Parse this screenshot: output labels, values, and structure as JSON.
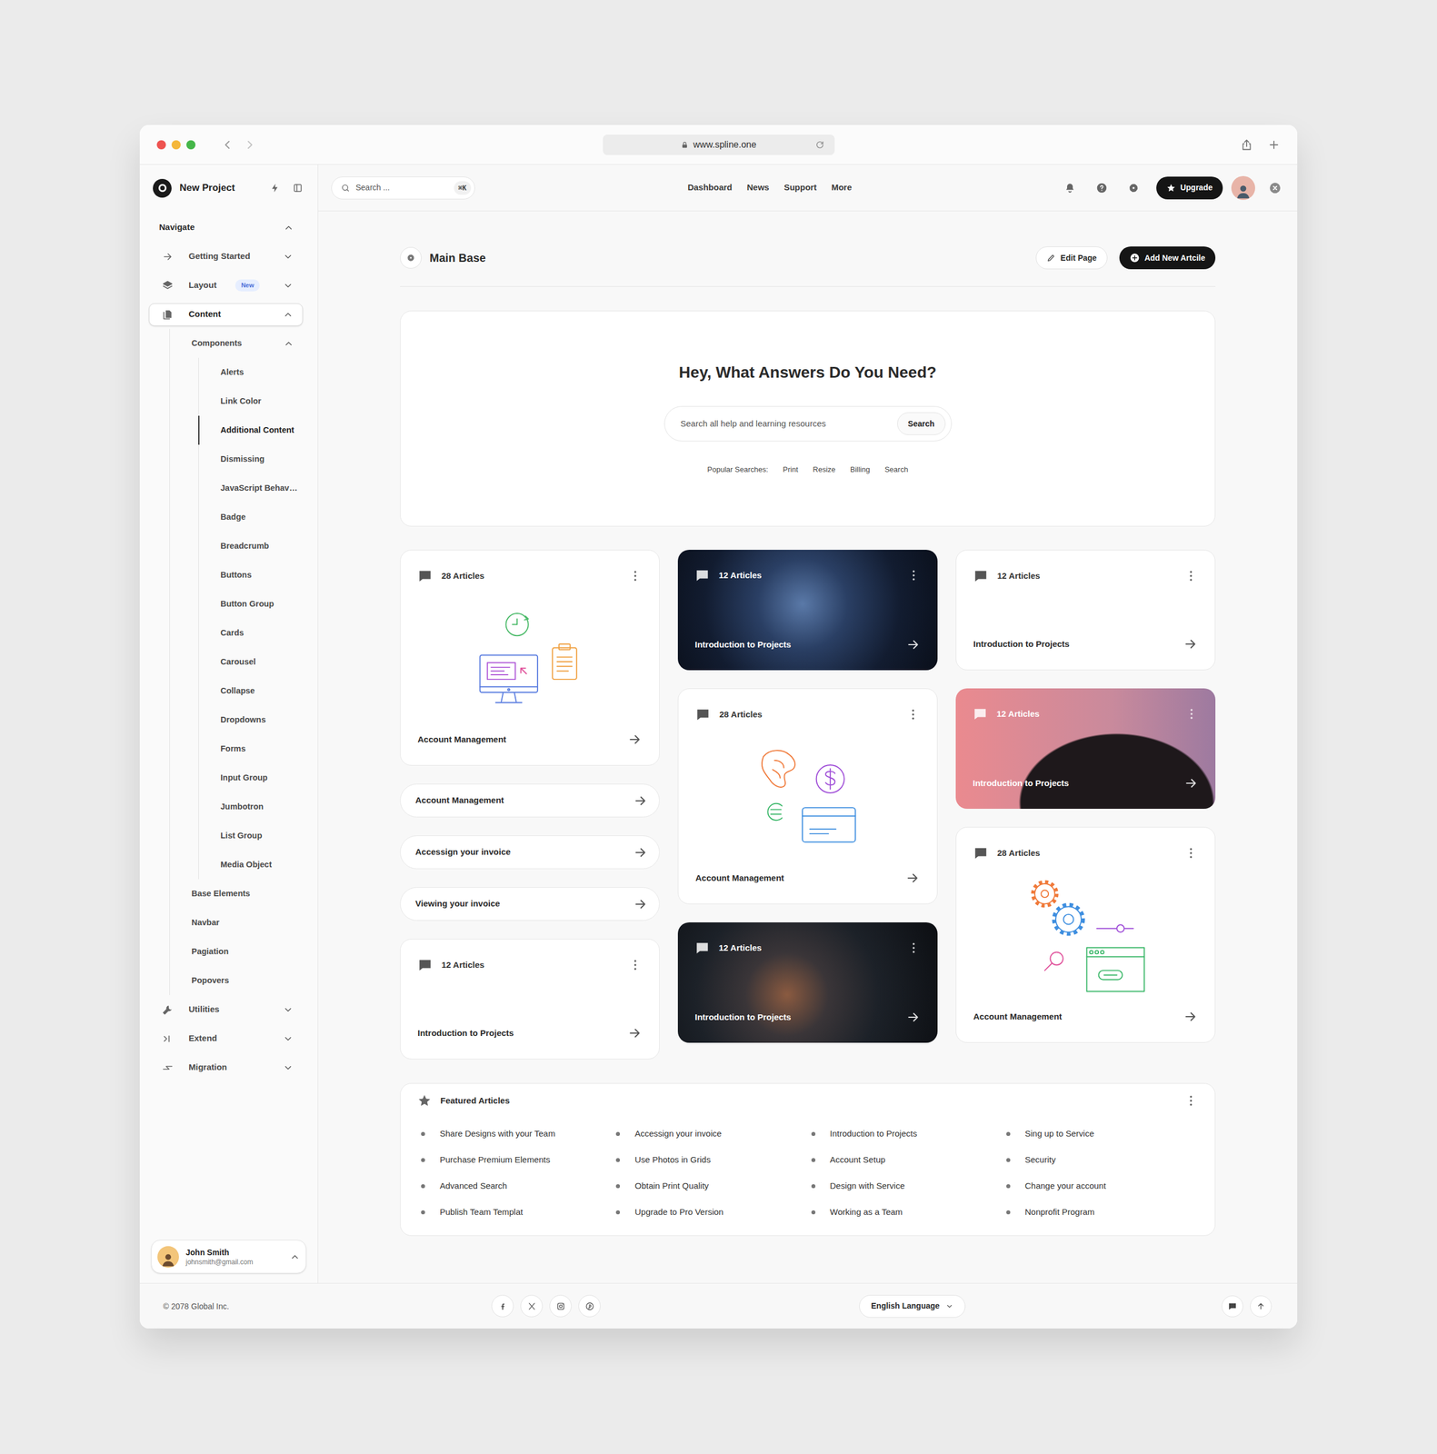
{
  "browser": {
    "url": "www.spline.one"
  },
  "sidebar": {
    "project": "New Project",
    "section": {
      "label": "Navigate",
      "expanded": true
    },
    "items": [
      {
        "label": "Getting Started",
        "expanded": false,
        "selected": false
      },
      {
        "label": "Layout",
        "badge": "New",
        "expanded": false,
        "selected": false
      },
      {
        "label": "Content",
        "expanded": true,
        "selected": true,
        "children": [
          {
            "label": "Components",
            "expanded": true,
            "children": [
              {
                "label": "Alerts",
                "selected": false
              },
              {
                "label": "Link Color",
                "selected": false
              },
              {
                "label": "Additional Content",
                "selected": true
              },
              {
                "label": "Dismissing",
                "selected": false
              },
              {
                "label": "JavaScript Behav…",
                "selected": false
              },
              {
                "label": "Badge",
                "selected": false
              },
              {
                "label": "Breadcrumb",
                "selected": false
              },
              {
                "label": "Buttons",
                "selected": false
              },
              {
                "label": "Button Group",
                "selected": false
              },
              {
                "label": "Cards",
                "selected": false
              },
              {
                "label": "Carousel",
                "selected": false
              },
              {
                "label": "Collapse",
                "selected": false
              },
              {
                "label": "Dropdowns",
                "selected": false
              },
              {
                "label": "Forms",
                "selected": false
              },
              {
                "label": "Input Group",
                "selected": false
              },
              {
                "label": "Jumbotron",
                "selected": false
              },
              {
                "label": "List Group",
                "selected": false
              },
              {
                "label": "Media Object",
                "selected": false
              }
            ]
          },
          {
            "label": "Base Elements"
          },
          {
            "label": "Navbar"
          },
          {
            "label": "Pagiation"
          },
          {
            "label": "Popovers"
          }
        ]
      },
      {
        "label": "Utilities",
        "expanded": false,
        "selected": false
      },
      {
        "label": "Extend",
        "expanded": false,
        "selected": false
      },
      {
        "label": "Migration",
        "expanded": false,
        "selected": false
      }
    ],
    "user": {
      "name": "John Smith",
      "email": "johnsmith@gmail.com"
    }
  },
  "header": {
    "search": {
      "placeholder": "Search ...",
      "shortcut": "⌘K"
    },
    "nav": [
      "Dashboard",
      "News",
      "Support",
      "More"
    ],
    "upgrade": "Upgrade"
  },
  "page": {
    "title": "Main Base",
    "edit": "Edit Page",
    "add": "Add New Artcile"
  },
  "hero": {
    "title": "Hey, What Answers Do You Need?",
    "placeholder": "Search all help and learning resources",
    "button": "Search",
    "popular_label": "Popular Searches:",
    "popular": [
      "Print",
      "Resize",
      "Billing",
      "Search"
    ]
  },
  "cards": {
    "columns": [
      [
        {
          "kind": "illustration",
          "count": "28 Articles",
          "title": "Account Management"
        },
        {
          "kind": "link",
          "title": "Account Management"
        },
        {
          "kind": "link",
          "title": "Accessign your invoice"
        },
        {
          "kind": "link",
          "title": "Viewing your invoice"
        },
        {
          "kind": "plain",
          "count": "12 Articles",
          "title": "Introduction to Projects"
        }
      ],
      [
        {
          "kind": "photo",
          "count": "12 Articles",
          "title": "Introduction to Projects"
        },
        {
          "kind": "illustration",
          "count": "28 Articles",
          "title": "Account Management"
        },
        {
          "kind": "photo",
          "count": "12 Articles",
          "title": "Introduction to Projects"
        }
      ],
      [
        {
          "kind": "plain",
          "count": "12 Articles",
          "title": "Introduction to Projects"
        },
        {
          "kind": "photo",
          "count": "12 Articles",
          "title": "Introduction to Projects"
        },
        {
          "kind": "illustration",
          "count": "28 Articles",
          "title": "Account Management"
        }
      ]
    ]
  },
  "featured": {
    "title": "Featured Articles",
    "columns": [
      [
        "Share Designs with your Team",
        "Purchase Premium Elements",
        "Advanced Search",
        "Publish Team Templat"
      ],
      [
        "Accessign your invoice",
        "Use Photos in Grids",
        "Obtain Print Quality",
        "Upgrade to Pro Version"
      ],
      [
        "Introduction to Projects",
        "Account Setup",
        "Design with Service",
        "Working as a Team"
      ],
      [
        "Sing up to Service",
        "Security",
        "Change your account",
        "Nonprofit Program"
      ]
    ]
  },
  "footer": {
    "copyright": "© 2078 Global Inc.",
    "language": "English Language"
  }
}
